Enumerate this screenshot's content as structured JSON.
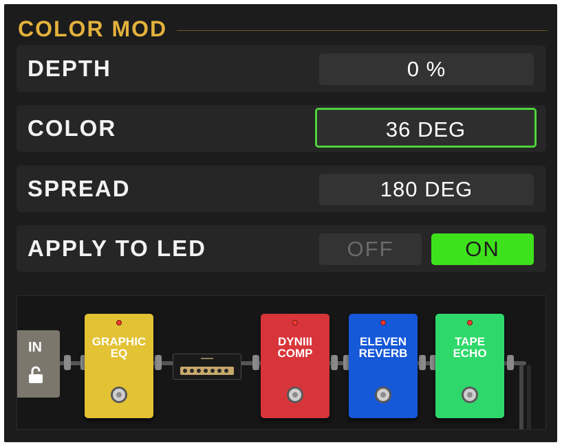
{
  "section": {
    "title": "COLOR MOD"
  },
  "params": [
    {
      "label": "DEPTH",
      "value": "0 %"
    },
    {
      "label": "COLOR",
      "value": "36 DEG"
    },
    {
      "label": "SPREAD",
      "value": "180 DEG"
    }
  ],
  "apply_to_led": {
    "label": "APPLY TO LED",
    "off_label": "OFF",
    "on_label": "ON",
    "selected": "ON"
  },
  "colors": {
    "accent": "#e3b23c",
    "selection": "#4fd43c",
    "on": "#3ee21c"
  },
  "signal_chain": {
    "input_label": "IN",
    "input_icon": "unlocked-padlock-icon",
    "amp": {
      "icon": "amp-head-icon"
    },
    "pedals": [
      {
        "name": "GRAPHIC\nEQ",
        "color": "#e3c234"
      },
      {
        "name": "DYNIII\nCOMP",
        "color": "#d8353a"
      },
      {
        "name": "ELEVEN\nREVERB",
        "color": "#1558d8"
      },
      {
        "name": "TAPE\nECHO",
        "color": "#2fd86a"
      }
    ]
  }
}
